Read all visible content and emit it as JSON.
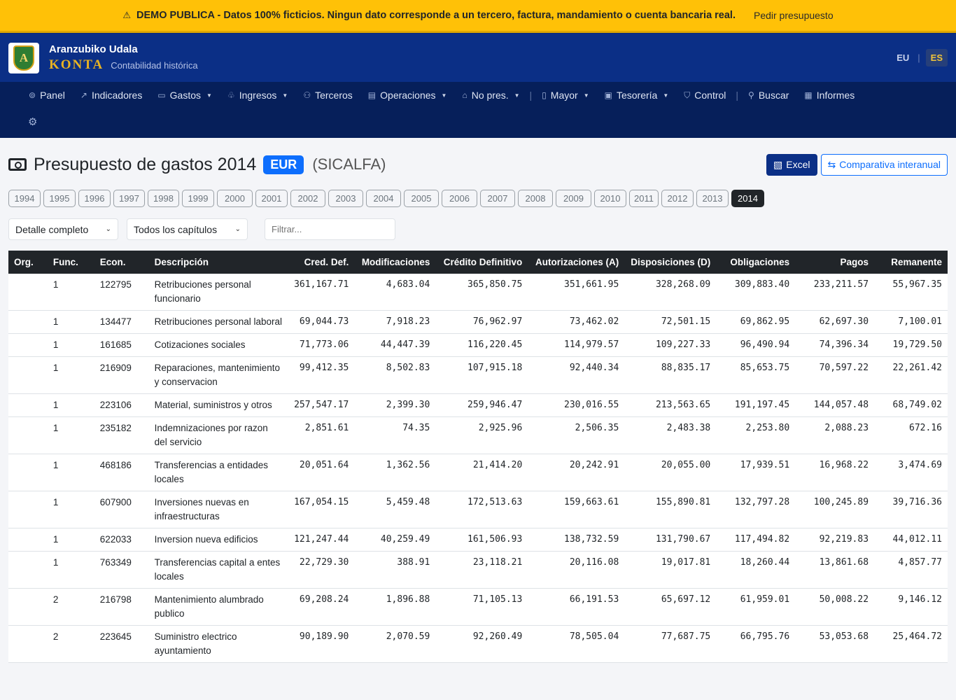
{
  "banner": {
    "icon": "warning-icon",
    "text": "DEMO PUBLICA - Datos 100% ficticios. Ningun dato corresponde a un tercero, factura, mandamiento o cuenta bancaria real.",
    "link": "Pedir presupuesto"
  },
  "brand": {
    "logo_letter": "A",
    "name": "Aranzubiko Udala",
    "product": "KONTA",
    "tagline": "Contabilidad histórica"
  },
  "lang": {
    "eu": "EU",
    "sep": "|",
    "es": "ES"
  },
  "nav": {
    "items": [
      {
        "icon": "dashboard-icon",
        "glyph": "⊚",
        "label": "Panel",
        "caret": false
      },
      {
        "icon": "chart-line-icon",
        "glyph": "↗",
        "label": "Indicadores",
        "caret": false
      },
      {
        "icon": "cash-icon",
        "glyph": "▭",
        "label": "Gastos",
        "caret": true
      },
      {
        "icon": "piggy-bank-icon",
        "glyph": "♧",
        "label": "Ingresos",
        "caret": true
      },
      {
        "icon": "people-icon",
        "glyph": "⚇",
        "label": "Terceros",
        "caret": false
      },
      {
        "icon": "list-icon",
        "glyph": "▤",
        "label": "Operaciones",
        "caret": true
      },
      {
        "icon": "bank-icon",
        "glyph": "⌂",
        "label": "No pres.",
        "caret": true
      },
      {
        "icon": "book-icon",
        "glyph": "▯",
        "label": "Mayor",
        "caret": true
      },
      {
        "icon": "safe-icon",
        "glyph": "▣",
        "label": "Tesorería",
        "caret": true
      },
      {
        "icon": "shield-check-icon",
        "glyph": "⛉",
        "label": "Control",
        "caret": false
      },
      {
        "icon": "search-icon",
        "glyph": "⚲",
        "label": "Buscar",
        "caret": false
      },
      {
        "icon": "report-icon",
        "glyph": "▦",
        "label": "Informes",
        "caret": false
      }
    ],
    "separator": "|",
    "settings_icon": "gear-icon"
  },
  "page": {
    "title": "Presupuesto de gastos 2014",
    "currency_badge": "EUR",
    "source": "(SICALFA)",
    "excel_label": "Excel",
    "compare_label": "Comparativa interanual"
  },
  "years": [
    "1994",
    "1995",
    "1996",
    "1997",
    "1998",
    "1999",
    "2000",
    "2001",
    "2002",
    "2003",
    "2004",
    "2005",
    "2006",
    "2007",
    "2008",
    "2009",
    "2010",
    "2011",
    "2012",
    "2013",
    "2014"
  ],
  "selected_year": "2014",
  "filters": {
    "detail_select": "Detalle completo",
    "chapter_select": "Todos los capítulos",
    "filter_placeholder": "Filtrar..."
  },
  "table": {
    "columns": [
      "Org.",
      "Func.",
      "Econ.",
      "Descripción",
      "Cred. Def.",
      "Modificaciones",
      "Crédito Definitivo",
      "Autorizaciones (A)",
      "Disposiciones (D)",
      "Obligaciones",
      "Pagos",
      "Remanente"
    ],
    "rows": [
      [
        "",
        "1",
        "122795",
        "Retribuciones personal funcionario",
        "361,167.71",
        "4,683.04",
        "365,850.75",
        "351,661.95",
        "328,268.09",
        "309,883.40",
        "233,211.57",
        "55,967.35"
      ],
      [
        "",
        "1",
        "134477",
        "Retribuciones personal laboral",
        "69,044.73",
        "7,918.23",
        "76,962.97",
        "73,462.02",
        "72,501.15",
        "69,862.95",
        "62,697.30",
        "7,100.01"
      ],
      [
        "",
        "1",
        "161685",
        "Cotizaciones sociales",
        "71,773.06",
        "44,447.39",
        "116,220.45",
        "114,979.57",
        "109,227.33",
        "96,490.94",
        "74,396.34",
        "19,729.50"
      ],
      [
        "",
        "1",
        "216909",
        "Reparaciones, mantenimiento y conservacion",
        "99,412.35",
        "8,502.83",
        "107,915.18",
        "92,440.34",
        "88,835.17",
        "85,653.75",
        "70,597.22",
        "22,261.42"
      ],
      [
        "",
        "1",
        "223106",
        "Material, suministros y otros",
        "257,547.17",
        "2,399.30",
        "259,946.47",
        "230,016.55",
        "213,563.65",
        "191,197.45",
        "144,057.48",
        "68,749.02"
      ],
      [
        "",
        "1",
        "235182",
        "Indemnizaciones por razon del servicio",
        "2,851.61",
        "74.35",
        "2,925.96",
        "2,506.35",
        "2,483.38",
        "2,253.80",
        "2,088.23",
        "672.16"
      ],
      [
        "",
        "1",
        "468186",
        "Transferencias a entidades locales",
        "20,051.64",
        "1,362.56",
        "21,414.20",
        "20,242.91",
        "20,055.00",
        "17,939.51",
        "16,968.22",
        "3,474.69"
      ],
      [
        "",
        "1",
        "607900",
        "Inversiones nuevas en infraestructuras",
        "167,054.15",
        "5,459.48",
        "172,513.63",
        "159,663.61",
        "155,890.81",
        "132,797.28",
        "100,245.89",
        "39,716.36"
      ],
      [
        "",
        "1",
        "622033",
        "Inversion nueva edificios",
        "121,247.44",
        "40,259.49",
        "161,506.93",
        "138,732.59",
        "131,790.67",
        "117,494.82",
        "92,219.83",
        "44,012.11"
      ],
      [
        "",
        "1",
        "763349",
        "Transferencias capital a entes locales",
        "22,729.30",
        "388.91",
        "23,118.21",
        "20,116.08",
        "19,017.81",
        "18,260.44",
        "13,861.68",
        "4,857.77"
      ],
      [
        "",
        "2",
        "216798",
        "Mantenimiento alumbrado publico",
        "69,208.24",
        "1,896.88",
        "71,105.13",
        "66,191.53",
        "65,697.12",
        "61,959.01",
        "50,008.22",
        "9,146.12"
      ],
      [
        "",
        "2",
        "223645",
        "Suministro electrico ayuntamiento",
        "90,189.90",
        "2,070.59",
        "92,260.49",
        "78,505.04",
        "77,687.75",
        "66,795.76",
        "53,053.68",
        "25,464.72"
      ]
    ]
  }
}
